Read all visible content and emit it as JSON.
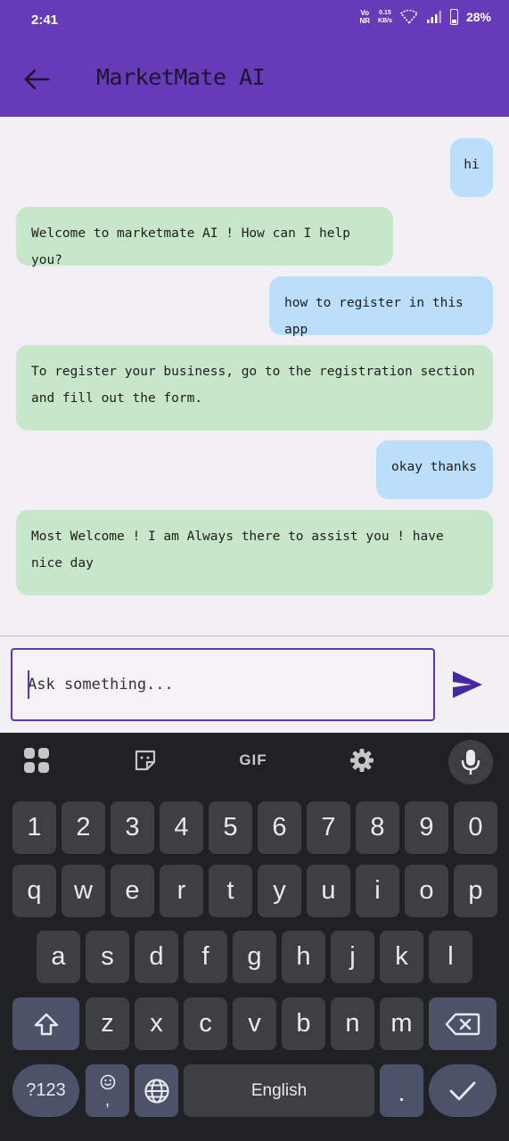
{
  "status_bar": {
    "time": "2:41",
    "vonr_top": "Vo",
    "vonr_bottom": "NR",
    "speed_value": "0.15",
    "speed_unit": "KB/s",
    "battery": "28%"
  },
  "app_bar": {
    "title": "MarketMate AI",
    "back_icon": "arrow-left-icon"
  },
  "messages": [
    {
      "sender": "user",
      "text": "hi"
    },
    {
      "sender": "bot",
      "text": "Welcome to marketmate AI ! How can I help you?"
    },
    {
      "sender": "user",
      "text": "how to register in this app"
    },
    {
      "sender": "bot",
      "text": "To register your business, go to the registration section and fill out the form."
    },
    {
      "sender": "user",
      "text": "okay thanks"
    },
    {
      "sender": "bot",
      "text": "Most Welcome ! I am Always there to assist you ! have nice day"
    }
  ],
  "input": {
    "placeholder": "Ask something...",
    "value": ""
  },
  "send_icon": "send-icon",
  "keyboard": {
    "toolbar": {
      "apps_icon": "grid-icon",
      "sticker_icon": "sticker-icon",
      "gif": "GIF",
      "settings_icon": "gear-icon",
      "mic_icon": "mic-icon"
    },
    "row_numbers": [
      "1",
      "2",
      "3",
      "4",
      "5",
      "6",
      "7",
      "8",
      "9",
      "0"
    ],
    "row_1": [
      "q",
      "w",
      "e",
      "r",
      "t",
      "y",
      "u",
      "i",
      "o",
      "p"
    ],
    "row_2": [
      "a",
      "s",
      "d",
      "f",
      "g",
      "h",
      "j",
      "k",
      "l"
    ],
    "row_3": [
      "z",
      "x",
      "c",
      "v",
      "b",
      "n",
      "m"
    ],
    "symbols": "?123",
    "comma": ",",
    "space": "English",
    "period": ".",
    "shift_icon": "shift-icon",
    "backspace_icon": "backspace-icon",
    "emoji_icon": "emoji-icon",
    "globe_icon": "globe-icon",
    "enter_icon": "check-icon"
  },
  "colors": {
    "primary": "#673ab7",
    "user_bubble": "#bbdefb",
    "bot_bubble": "#c8e6c9",
    "keyboard_bg": "#202124",
    "key_bg": "#3c4043",
    "accent_key_bg": "#4c5368"
  }
}
